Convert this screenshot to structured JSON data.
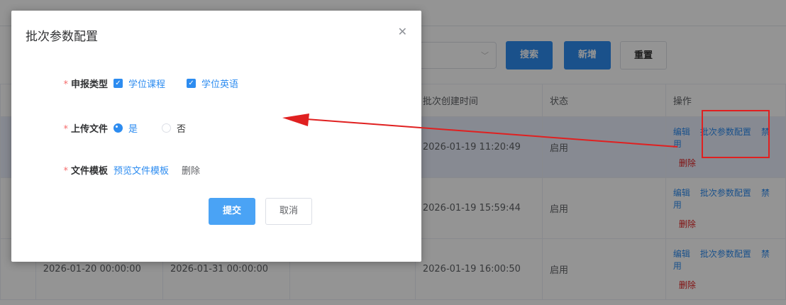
{
  "toolbar": {
    "search_label": "搜索",
    "add_label": "新增",
    "reset_label": "重置"
  },
  "table": {
    "headers": [
      "批次创建时间",
      "状态",
      "操作"
    ],
    "rows": [
      {
        "start": "",
        "end": "",
        "created": "2026-01-19 11:20:49",
        "status": "启用"
      },
      {
        "start": "",
        "end": "",
        "created": "2026-01-19 15:59:44",
        "status": "启用"
      },
      {
        "start": "2026-01-20 00:00:00",
        "end": "2026-01-31 00:00:00",
        "created": "2026-01-19 16:00:50",
        "status": "启用"
      }
    ],
    "ops": {
      "edit": "编辑",
      "batch_config": "批次参数配置",
      "disable": "禁用",
      "delete": "删除"
    }
  },
  "dialog": {
    "title": "批次参数配置",
    "close_icon": "close-icon",
    "report_type": {
      "label": "申报类型",
      "options": [
        "学位课程",
        "学位英语"
      ]
    },
    "upload": {
      "label": "上传文件",
      "yes": "是",
      "no": "否",
      "selected": "是"
    },
    "template": {
      "label": "文件模板",
      "preview": "预览文件模板",
      "delete": "删除"
    },
    "required_mark": "*",
    "submit_label": "提交",
    "cancel_label": "取消"
  },
  "colors": {
    "primary": "#2d8cf0",
    "danger": "#e02020",
    "annotation": "#e02020"
  }
}
